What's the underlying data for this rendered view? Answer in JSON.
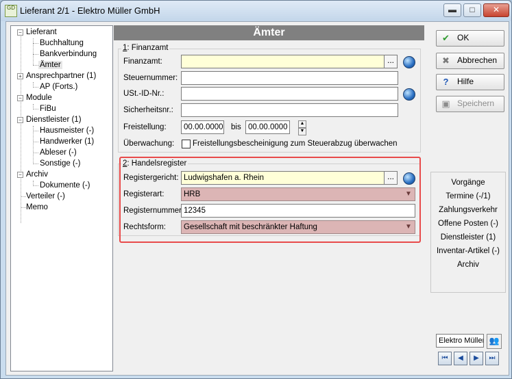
{
  "window": {
    "title": "Lieferant 2/1 - Elektro Müller GmbH",
    "app_icon_text": "GD",
    "minimize": "▬",
    "maximize": "□",
    "close": "✕"
  },
  "tree": {
    "items": [
      {
        "label": "Lieferant",
        "box": "−"
      },
      {
        "label": "Buchhaltung"
      },
      {
        "label": "Bankverbindung"
      },
      {
        "label": "Ämter"
      },
      {
        "label": "Ansprechpartner (1)",
        "box": "+"
      },
      {
        "label": "AP (Forts.)"
      },
      {
        "label": "Module",
        "box": "−"
      },
      {
        "label": "FiBu"
      },
      {
        "label": "Dienstleister (1)",
        "box": "−"
      },
      {
        "label": "Hausmeister (-)"
      },
      {
        "label": "Handwerker (1)"
      },
      {
        "label": "Ableser (-)"
      },
      {
        "label": "Sonstige (-)"
      },
      {
        "label": "Archiv",
        "box": "−"
      },
      {
        "label": "Dokumente (-)"
      },
      {
        "label": "Verteiler (-)"
      },
      {
        "label": "Memo"
      }
    ]
  },
  "main": {
    "header": "Ämter",
    "finanzamt": {
      "group_label_num": "1",
      "group_label_text": ": Finanzamt",
      "finanzamt_label": "Finanzamt:",
      "finanzamt_value": "",
      "steuernummer_label": "Steuernummer:",
      "steuernummer_value": "",
      "ustid_label": "USt.-ID-Nr.:",
      "ustid_value": "",
      "sicherheit_label": "Sicherheitsnr.:",
      "sicherheit_value": "",
      "freistellung_label": "Freistellung:",
      "freistellung_from": "00.00.0000",
      "bis_label": "bis",
      "freistellung_to": "00.00.0000",
      "ueberwachung_label": "Überwachung:",
      "ueberwachung_checkbox": "Freistellungsbescheinigung zum Steuerabzug überwachen",
      "browse": "..."
    },
    "handelsregister": {
      "group_label_num": "2",
      "group_label_text": ": Handelsregister",
      "gericht_label": "Registergericht:",
      "gericht_value": "Ludwigshafen a. Rhein",
      "art_label": "Registerart:",
      "art_value": "HRB",
      "nummer_label": "Registernummer:",
      "nummer_value": "12345",
      "rechtsform_label": "Rechtsform:",
      "rechtsform_value": "Gesellschaft mit beschränkter Haftung",
      "browse": "..."
    }
  },
  "actions": {
    "ok": "OK",
    "abbrechen": "Abbrechen",
    "hilfe": "Hilfe",
    "speichern": "Speichern"
  },
  "links": [
    "Vorgänge",
    "Termine (-/1)",
    "Zahlungsverkehr",
    "Offene Posten (-)",
    "Dienstleister (1)",
    "Inventar-Artikel (-)",
    "Archiv"
  ],
  "footer": {
    "search_value": "Elektro Müller",
    "nav": [
      "⏮",
      "◀",
      "▶",
      "⏭"
    ]
  }
}
